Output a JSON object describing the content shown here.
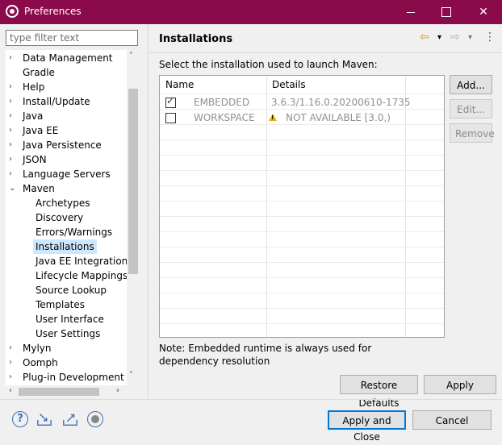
{
  "window": {
    "title": "Preferences",
    "minimize_icon": "minimize-icon",
    "maximize_icon": "maximize-icon",
    "close_icon": "close-icon"
  },
  "colors": {
    "titlebar": "#8b0a4c",
    "selection": "#cce8ff",
    "default_button_border": "#0078d7",
    "warning": "#e6b400"
  },
  "sidebar": {
    "filter_placeholder": "type filter text",
    "items": [
      {
        "label": "Data Management",
        "chevron": "›",
        "child": false
      },
      {
        "label": "Gradle",
        "chevron": "",
        "child": false
      },
      {
        "label": "Help",
        "chevron": "›",
        "child": false
      },
      {
        "label": "Install/Update",
        "chevron": "›",
        "child": false
      },
      {
        "label": "Java",
        "chevron": "›",
        "child": false
      },
      {
        "label": "Java EE",
        "chevron": "›",
        "child": false
      },
      {
        "label": "Java Persistence",
        "chevron": "›",
        "child": false
      },
      {
        "label": "JSON",
        "chevron": "›",
        "child": false
      },
      {
        "label": "Language Servers",
        "chevron": "›",
        "child": false
      },
      {
        "label": "Maven",
        "chevron": "⌄",
        "child": false
      },
      {
        "label": "Archetypes",
        "chevron": "",
        "child": true
      },
      {
        "label": "Discovery",
        "chevron": "",
        "child": true
      },
      {
        "label": "Errors/Warnings",
        "chevron": "",
        "child": true
      },
      {
        "label": "Installations",
        "chevron": "",
        "child": true,
        "selected": true
      },
      {
        "label": "Java EE Integration",
        "chevron": "",
        "child": true
      },
      {
        "label": "Lifecycle Mappings",
        "chevron": "",
        "child": true
      },
      {
        "label": "Source Lookup",
        "chevron": "",
        "child": true
      },
      {
        "label": "Templates",
        "chevron": "",
        "child": true
      },
      {
        "label": "User Interface",
        "chevron": "",
        "child": true
      },
      {
        "label": "User Settings",
        "chevron": "",
        "child": true
      },
      {
        "label": "Mylyn",
        "chevron": "›",
        "child": false
      },
      {
        "label": "Oomph",
        "chevron": "›",
        "child": false
      },
      {
        "label": "Plug-in Development",
        "chevron": "›",
        "child": false
      }
    ],
    "scroll_up": "˄",
    "scroll_down": "˅",
    "scroll_left": "‹",
    "scroll_right": "›"
  },
  "page": {
    "title": "Installations",
    "back_icon": "⇦",
    "back_menu": "▾",
    "forward_icon": "⇨",
    "forward_menu": "▾",
    "more_icon": "⋮",
    "prompt": "Select the installation used to launch Maven:",
    "table": {
      "headers": [
        "Name",
        "Details"
      ],
      "rows": [
        {
          "checked": true,
          "name": "EMBEDDED",
          "details": "3.6.3/1.16.0.20200610-1735",
          "warning": false
        },
        {
          "checked": false,
          "name": "WORKSPACE",
          "details": "NOT AVAILABLE [3.0,)",
          "warning": true
        }
      ]
    },
    "buttons": {
      "add": "Add...",
      "edit": "Edit...",
      "remove": "Remove"
    },
    "note": "Note: Embedded runtime is always used for dependency resolution",
    "restore_defaults": "Restore Defaults",
    "apply": "Apply"
  },
  "footer": {
    "help_icon": "?",
    "apply_and_close": "Apply and Close",
    "cancel": "Cancel"
  }
}
